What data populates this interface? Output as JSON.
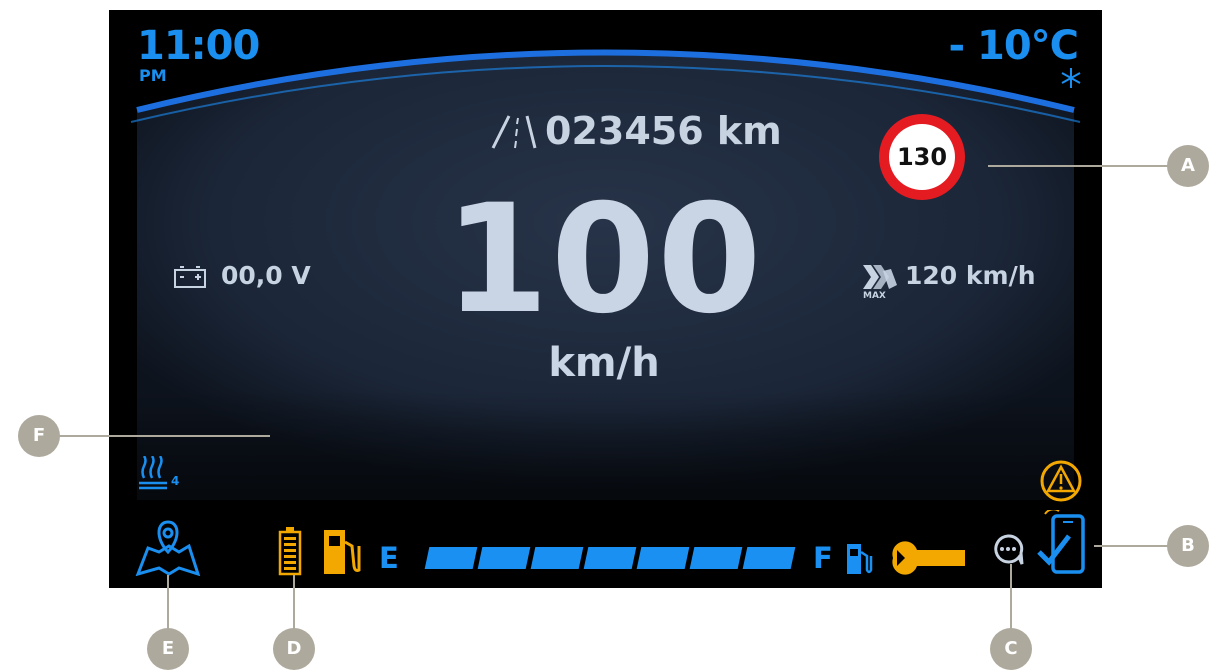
{
  "status": {
    "time": "11:00",
    "ampm": "PM",
    "temperature": "- 10°C"
  },
  "odometer": {
    "value": "023456 km",
    "icon": "road-icon"
  },
  "speedometer": {
    "value": "100",
    "unit": "km/h"
  },
  "battery": {
    "value": "00,0 V",
    "icon": "battery-icon"
  },
  "max_speed": {
    "value": "120 km/h",
    "icon_label": "MAX",
    "icon": "speed-max-icon"
  },
  "speed_limit": {
    "value": "130"
  },
  "heated_grips": {
    "level": "4",
    "icon": "heated-grips-icon"
  },
  "fuel": {
    "empty_label": "E",
    "full_label": "F",
    "segments": 7,
    "level_fraction": 1.0
  },
  "icons": [
    "map-pin-icon",
    "battery-level-icon",
    "fuel-pump-icon",
    "wrench-icon",
    "chat-bubble-icon",
    "phone-check-icon",
    "warning-triangle-icon",
    "snowflake-icon",
    "fuel-side-icon"
  ],
  "colors": {
    "accent": "#1a8ff0",
    "text": "#c8d3e2",
    "warning": "#f2a800",
    "limit_ring": "#e41c22",
    "callout": "#aea99d"
  },
  "callouts": [
    "A",
    "B",
    "C",
    "D",
    "E",
    "F"
  ]
}
